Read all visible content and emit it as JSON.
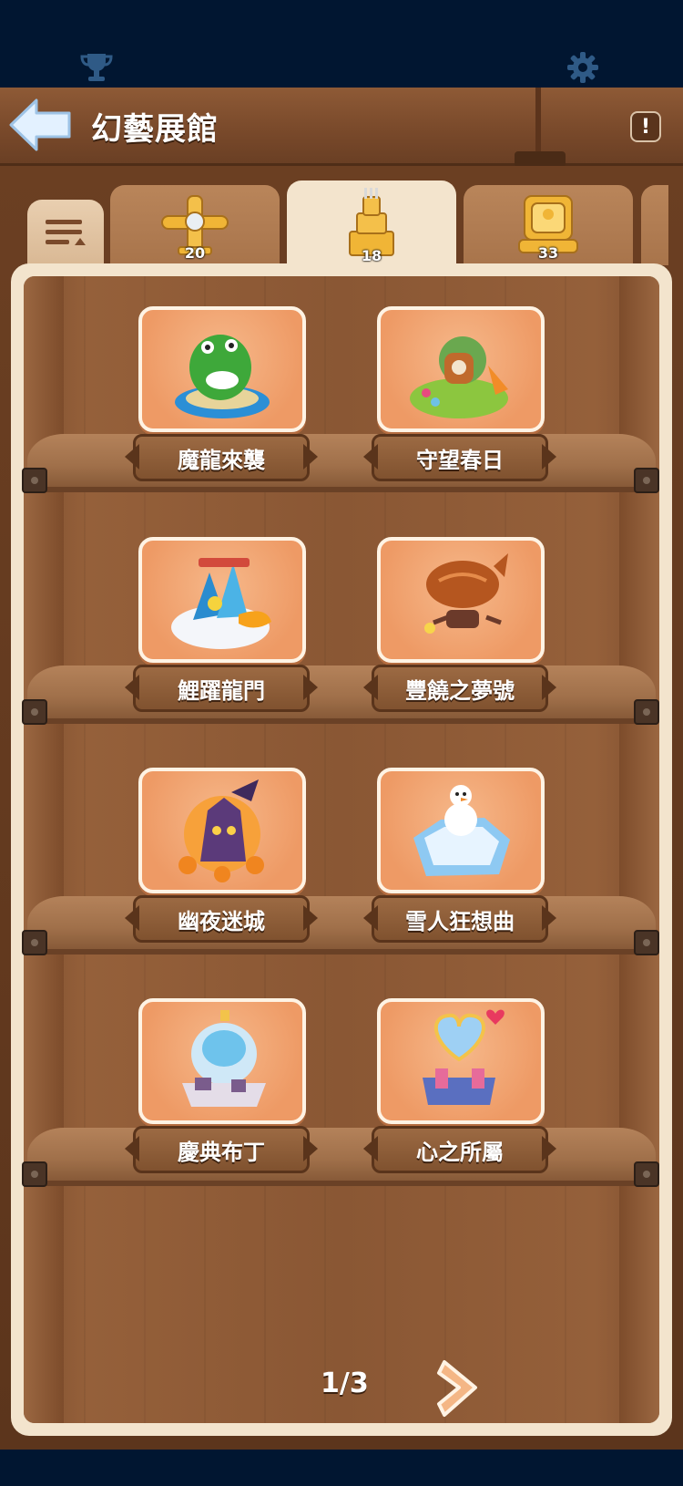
{
  "header": {
    "title": "幻藝展館"
  },
  "tabs": [
    {
      "name": "plane",
      "count": "20"
    },
    {
      "name": "tower",
      "count": "18"
    },
    {
      "name": "throne",
      "count": "33"
    }
  ],
  "items": [
    {
      "label": "魔龍來襲",
      "icon": "dragon-island-icon"
    },
    {
      "label": "守望春日",
      "icon": "spring-garden-icon"
    },
    {
      "label": "鯉躍龍門",
      "icon": "dragon-gate-icon"
    },
    {
      "label": "豐饒之夢號",
      "icon": "bread-airship-icon"
    },
    {
      "label": "幽夜迷城",
      "icon": "haunted-castle-icon"
    },
    {
      "label": "雪人狂想曲",
      "icon": "snowman-island-icon"
    },
    {
      "label": "慶典布丁",
      "icon": "pudding-castle-icon"
    },
    {
      "label": "心之所屬",
      "icon": "heart-palace-icon"
    }
  ],
  "pager": {
    "text": "1/3"
  },
  "colors": {
    "accent": "#ee9a65",
    "wood": "#7a4a2b",
    "background": "#011631"
  }
}
